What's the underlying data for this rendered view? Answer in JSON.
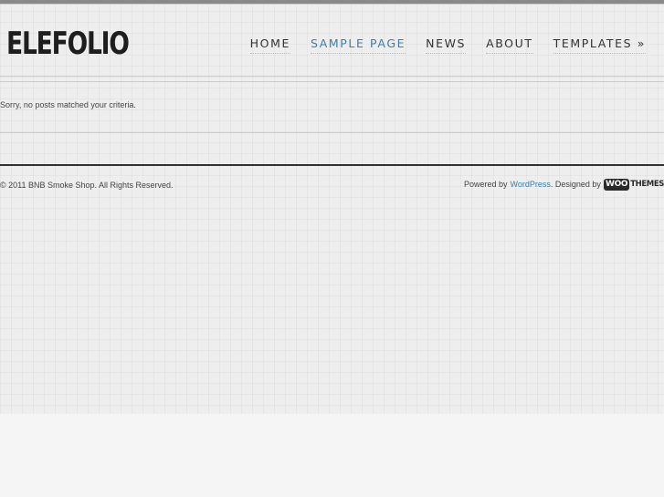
{
  "site": {
    "logo": "ELEFOLIO"
  },
  "nav": {
    "items": [
      {
        "label": "HOME",
        "active": false
      },
      {
        "label": "SAMPLE PAGE",
        "active": true
      },
      {
        "label": "NEWS",
        "active": false
      },
      {
        "label": "ABOUT",
        "active": false
      },
      {
        "label": "TEMPLATES »",
        "active": false
      }
    ]
  },
  "main": {
    "message": "Sorry, no posts matched your criteria."
  },
  "footer": {
    "copyright": "© 2011 BNB Smoke Shop. All Rights Reserved.",
    "powered_by": "Powered by",
    "wordpress_link": "WordPress",
    "designed_by": ". Designed by",
    "woo_logo_left": "WOO",
    "woo_logo_right": "THEMES"
  },
  "colors": {
    "accent_link": "#3d7ea6",
    "text": "#444444",
    "logo": "#1e1e1e"
  }
}
